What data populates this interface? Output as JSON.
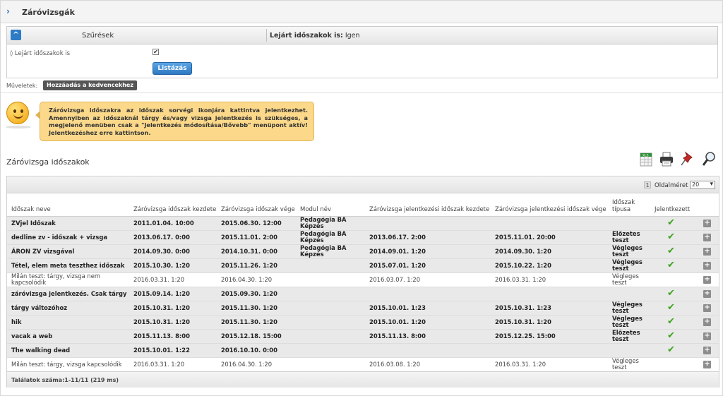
{
  "window": {
    "title": "Záróvizsgák"
  },
  "filter": {
    "header_label": "Szűrések",
    "summary_label": "Lejárt időszakok is:",
    "summary_value": "Igen",
    "option_label": "Lejárt időszakok is",
    "option_checked": true,
    "list_button": "Listázás"
  },
  "actions": {
    "label": "Műveletek:",
    "add_favorite": "Hozzáadás a kedvencekhez"
  },
  "notice": {
    "text": "Záróvizsga időszakra az időszak sorvégi ikonjára kattintva jelentkezhet. Amennyiben az időszaknál tárgy és/vagy vizsga jelentkezés is szükséges, a megjelenő menüben csak a \"Jelentkezés módosítása/Bővebb\" menüpont aktív! Jelentkezéshez erre kattintson."
  },
  "section": {
    "title": "Záróvizsga időszakok"
  },
  "toolbar_icons": [
    "excel-export-icon",
    "print-icon",
    "pin-icon",
    "search-icon"
  ],
  "pager": {
    "page": "1",
    "page_size_label": "Oldalméret",
    "page_size": "20"
  },
  "columns": [
    "Időszak neve",
    "Záróvizsga időszak kezdete",
    "Záróvizsga időszak vége",
    "Modul név",
    "Záróvizsga jelentkezési időszak kezdete",
    "Záróvizsga jelentkezési időszak vége",
    "Időszak típusa",
    "Jelentkezett"
  ],
  "rows": [
    {
      "style": "g",
      "name": "ZVjel Időszak",
      "start": "2011.01.04. 10:00",
      "end": "2015.06.30. 12:00",
      "module": "Pedagógia BA Képzés",
      "app_start": "",
      "app_end": "",
      "type": "",
      "applied": true
    },
    {
      "style": "g",
      "name": "dedline zv - időszak + vizsga",
      "start": "2013.06.17. 0:00",
      "end": "2015.11.01. 2:00",
      "module": "Pedagógia BA Képzés",
      "app_start": "2013.06.17. 2:00",
      "app_end": "2015.11.01. 20:00",
      "type": "Előzetes teszt",
      "applied": true
    },
    {
      "style": "g",
      "name": "ÁRON ZV vizsgával",
      "start": "2014.09.30. 0:00",
      "end": "2014.10.31. 0:00",
      "module": "Pedagógia BA Képzés",
      "app_start": "2014.09.01. 1:20",
      "app_end": "2014.09.30. 1:20",
      "type": "Végleges teszt",
      "applied": true
    },
    {
      "style": "g",
      "name": "Tétel, elem meta teszthez időszak",
      "start": "2015.10.30. 1:20",
      "end": "2015.11.26. 1:20",
      "module": "",
      "app_start": "2015.07.01. 1:20",
      "app_end": "2015.10.22. 1:20",
      "type": "Végleges teszt",
      "applied": true
    },
    {
      "style": "w",
      "name": "Milán teszt: tárgy, vizsga nem kapcsolódik",
      "start": "2016.03.31. 1:20",
      "end": "2016.04.30. 1:20",
      "module": "",
      "app_start": "2016.03.07. 1:20",
      "app_end": "2016.03.31. 1:20",
      "type": "Végleges teszt",
      "applied": false
    },
    {
      "style": "g",
      "name": "záróvizsga jelentkezés. Csak tárgy",
      "start": "2015.09.14. 1:20",
      "end": "2015.09.30. 1:20",
      "module": "",
      "app_start": "",
      "app_end": "",
      "type": "",
      "applied": true
    },
    {
      "style": "g",
      "name": "tárgy változóhoz",
      "start": "2015.10.31. 1:20",
      "end": "2015.11.30. 1:20",
      "module": "",
      "app_start": "2015.10.01. 1:23",
      "app_end": "2015.10.31. 1:23",
      "type": "Végleges teszt",
      "applied": true
    },
    {
      "style": "g",
      "name": "hik",
      "start": "2015.10.31. 1:20",
      "end": "2015.11.30. 1:20",
      "module": "",
      "app_start": "2015.10.01. 1:20",
      "app_end": "2015.10.31. 1:20",
      "type": "Végleges teszt",
      "applied": true
    },
    {
      "style": "g",
      "name": "vacak a web",
      "start": "2015.11.13. 8:00",
      "end": "2015.12.18. 15:00",
      "module": "",
      "app_start": "2015.11.13. 8:00",
      "app_end": "2015.12.25. 15:00",
      "type": "Előzetes teszt",
      "applied": true
    },
    {
      "style": "g",
      "name": "The walking dead",
      "start": "2015.10.01. 1:22",
      "end": "2016.10.10. 0:00",
      "module": "",
      "app_start": "",
      "app_end": "",
      "type": "",
      "applied": true
    },
    {
      "style": "w",
      "name": "Milán teszt: tárgy, vizsga kapcsolódik",
      "start": "2016.03.31. 1:20",
      "end": "2016.04.30. 1:20",
      "module": "",
      "app_start": "2016.03.08. 1:20",
      "app_end": "2016.03.31. 1:20",
      "type": "Végleges teszt",
      "applied": false
    }
  ],
  "footer": {
    "text": "Találatok száma:1-11/11 (219 ms)"
  }
}
